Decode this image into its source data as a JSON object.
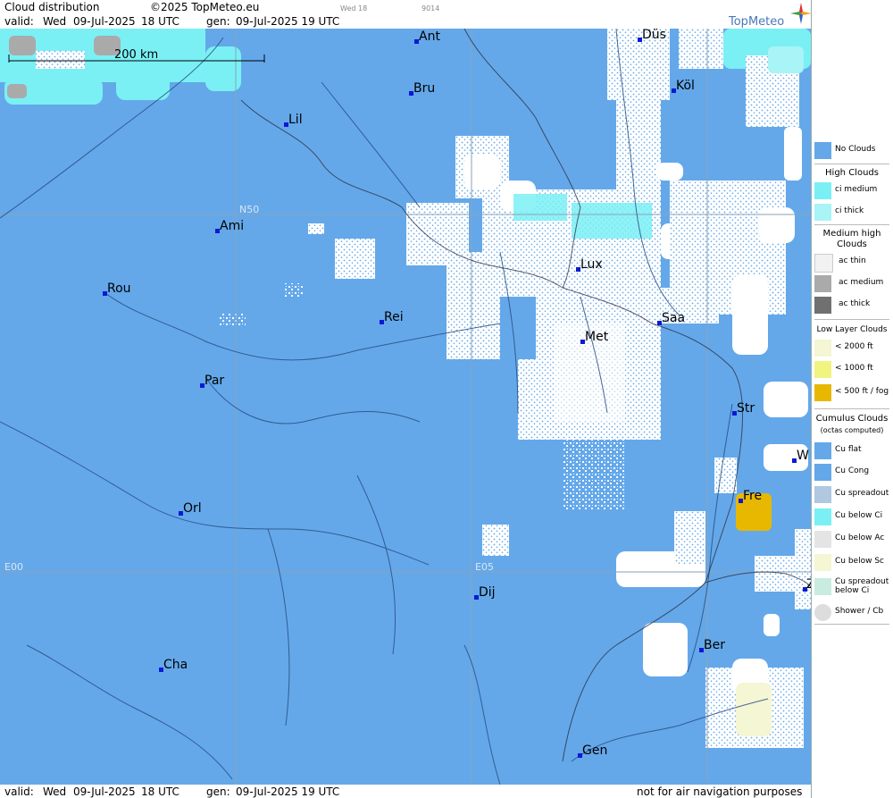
{
  "header": {
    "product": "Cloud distribution",
    "copyright": "©2025 TopMeteo.eu",
    "valid_label": "valid:",
    "valid_day": "Wed",
    "valid_date": "09-Jul-2025",
    "valid_time": "18 UTC",
    "gen_label": "gen:",
    "gen_value": "09-Jul-2025 19 UTC",
    "small_day": "Wed 18",
    "small_code": "9014",
    "brand": "TopMeteo"
  },
  "scale": {
    "label": "200 km"
  },
  "grid_labels": {
    "lat50": "N50",
    "lon0": "E00",
    "lon5": "E05"
  },
  "cities": [
    {
      "code": "Ant"
    },
    {
      "code": "Düs"
    },
    {
      "code": "Bru"
    },
    {
      "code": "Köl"
    },
    {
      "code": "Lil"
    },
    {
      "code": "Ami"
    },
    {
      "code": "Lux"
    },
    {
      "code": "Rou"
    },
    {
      "code": "Rei"
    },
    {
      "code": "Saa"
    },
    {
      "code": "Met"
    },
    {
      "code": "Par"
    },
    {
      "code": "Str"
    },
    {
      "code": "W"
    },
    {
      "code": "Fre"
    },
    {
      "code": "Orl"
    },
    {
      "code": "Dij"
    },
    {
      "code": "Ber"
    },
    {
      "code": "Cha"
    },
    {
      "code": "Gen"
    },
    {
      "code": "Z"
    }
  ],
  "legend": {
    "no_clouds": "No Clouds",
    "high_head": "High Clouds",
    "high": [
      "ci medium",
      "ci thick"
    ],
    "medium_head": "Medium high Clouds",
    "medium": [
      "ac thin",
      "ac medium",
      "ac thick"
    ],
    "low_head": "Low Layer Clouds",
    "low": [
      "< 2000 ft",
      "< 1000 ft",
      "< 500 ft / fog"
    ],
    "cu_head": "Cumulus Clouds",
    "cu_sub": "(octas computed)",
    "cu": [
      "Cu flat",
      "Cu Cong",
      "Cu spreadout",
      "Cu below Ci",
      "Cu below Ac",
      "Cu below Sc",
      "Cu spreadout below Ci",
      "Shower / Cb"
    ]
  },
  "footer": {
    "valid_label": "valid:",
    "valid_day": "Wed",
    "valid_date": "09-Jul-2025",
    "valid_time": "18 UTC",
    "gen_label": "gen:",
    "gen_value": "09-Jul-2025 19 UTC",
    "disclaimer": "not for air navigation purposes"
  },
  "colors": {
    "no_clouds": "#64a8ea",
    "ci_medium": "#7af0f4",
    "ci_thick": "#a8f4f6",
    "ac_thin": "#f2f2f2",
    "ac_medium": "#aaaaaa",
    "ac_thick": "#707070",
    "low_2000": "#f4f6d4",
    "low_1000": "#f2f480",
    "low_500": "#e8b800",
    "cu_white": "#ffffff"
  }
}
